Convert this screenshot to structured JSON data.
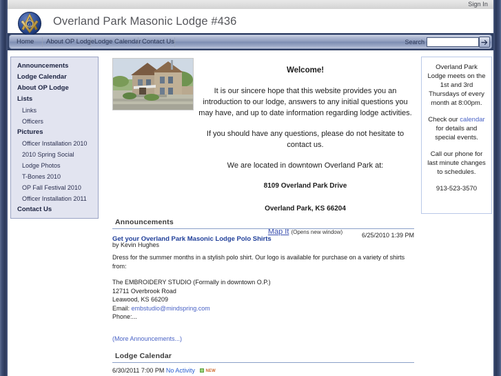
{
  "browser": {
    "signin_label": "Sign In"
  },
  "header": {
    "site_title": "Overland Park Masonic Lodge #436",
    "logo_alt": "masonic-square-and-compasses-logo"
  },
  "nav": {
    "items": [
      {
        "label": "Home"
      },
      {
        "label": "About OP Lodge"
      },
      {
        "label": "Lodge Calendar"
      },
      {
        "label": "Contact Us"
      }
    ],
    "search_label": "Search",
    "search_value": "",
    "search_placeholder": "",
    "search_go_icon": "arrow-right-icon"
  },
  "sidebar": {
    "items": [
      {
        "label": "Announcements",
        "level": "top"
      },
      {
        "label": "Lodge Calendar",
        "level": "top"
      },
      {
        "label": "About OP Lodge",
        "level": "top"
      },
      {
        "label": "Lists",
        "level": "top"
      },
      {
        "label": "Links",
        "level": "sub"
      },
      {
        "label": "Officers",
        "level": "sub"
      },
      {
        "label": "Pictures",
        "level": "top"
      },
      {
        "label": "Officer Installation 2010",
        "level": "sub"
      },
      {
        "label": "2010 Spring Social",
        "level": "sub"
      },
      {
        "label": "Lodge Photos",
        "level": "sub"
      },
      {
        "label": "T-Bones 2010",
        "level": "sub"
      },
      {
        "label": "OP Fall Festival 2010",
        "level": "sub"
      },
      {
        "label": "Officer Installation 2011",
        "level": "sub"
      },
      {
        "label": "Contact Us",
        "level": "top"
      }
    ]
  },
  "welcome": {
    "photo_alt": "lodge-building-photo",
    "heading": "Welcome!",
    "para1": "It is our sincere hope that this website provides you an introduction to our lodge, answers to any initial questions you may have, and up to date information regarding lodge activities.",
    "para2": "If you should have any questions, please do not hesitate to contact us.",
    "para3": "We are located in downtown Overland Park at:",
    "address_line1": "8109 Overland Park Drive",
    "address_line2": "Overland Park, KS 66204",
    "map_link": "Map It",
    "map_note": "(Opens new window)"
  },
  "info_panel": {
    "para1": "Overland Park Lodge meets on the 1st and 3rd Thursdays of every month at 8:00pm.",
    "para2_before": "Check our ",
    "para2_link": "calendar",
    "para2_after": " for details and special events.",
    "para3": "Call our phone for last minute changes to schedules.",
    "phone": "913-523-3570"
  },
  "announcements": {
    "section_title": "Announcements",
    "items": [
      {
        "title": "Get your Overland Park Masonic Lodge Polo Shirts",
        "date": "6/25/2010 1:39 PM",
        "by": "by Kevin Hughes",
        "body_line1": "Dress for the summer months in a stylish polo shirt. Our logo is available for purchase on a variety of shirts from:",
        "body_line2": "The EMBROIDERY STUDIO (Formally in downtown O.P.)",
        "body_line3": "12711 Overbrook Road",
        "body_line4": "Leawood, KS 66209",
        "email_label": "Email:",
        "email": "embstudio@mindspring.com",
        "phone_line": "Phone:..."
      }
    ],
    "more_link": "(More Announcements...)"
  },
  "calendar": {
    "section_title": "Lodge Calendar",
    "rows": [
      {
        "datetime": "6/30/2011 7:00 PM",
        "title": "No Activity",
        "badge": "NEW",
        "badge_icon": "new-item-icon"
      }
    ]
  },
  "colors": {
    "frame_blue": "#2f3f63",
    "nav_blue": "#8e9cbd",
    "link_blue": "#4a63c6",
    "ann_title_blue": "#21409a",
    "panel_bg": "#e2e4f0",
    "rule_blue": "#8a9fc8"
  }
}
